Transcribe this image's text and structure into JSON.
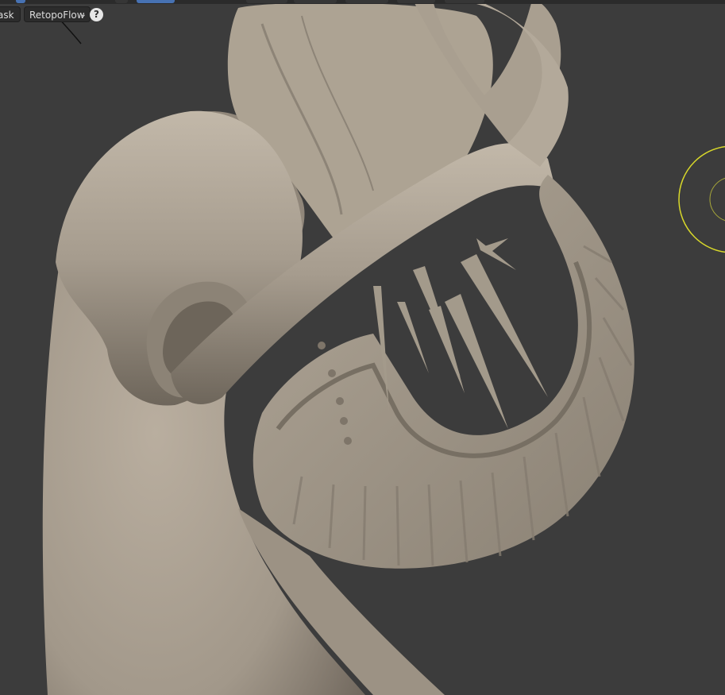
{
  "header": {
    "mask_label": "ask",
    "addon_label": "RetopoFlow",
    "help_label": "?"
  },
  "icons": {
    "dropdown": "chevron-down-icon",
    "help": "help-icon",
    "brush_cursor": "brush-cursor-icon"
  },
  "colors": {
    "viewport_bg": "#3c3c3c",
    "sculpt_clay": "#a89e90",
    "brush_cursor": "#d8d82a",
    "accent_tab": "#4772b3"
  }
}
